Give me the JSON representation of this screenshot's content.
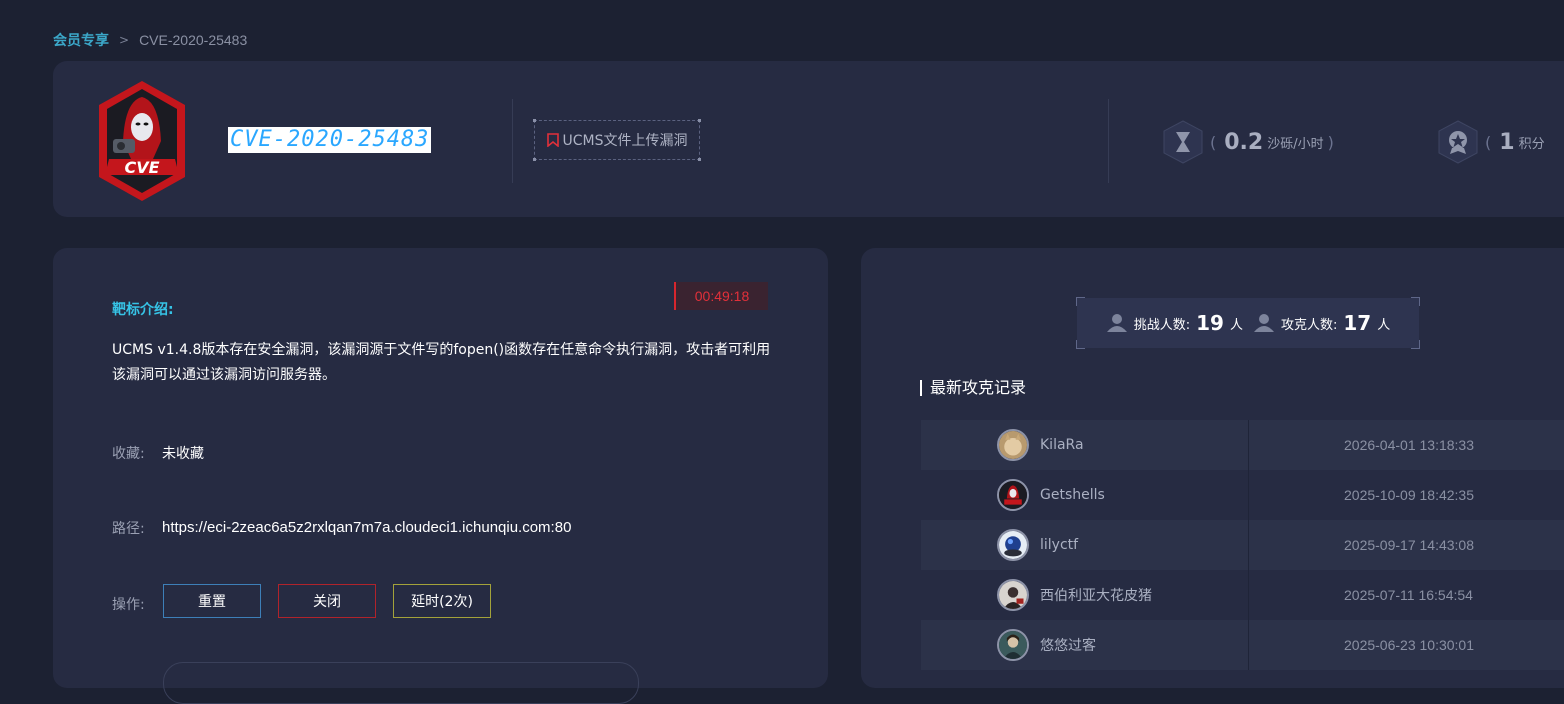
{
  "breadcrumb": {
    "parent": "会员专享",
    "separator": ">",
    "current": "CVE-2020-25483"
  },
  "header": {
    "logo_text": "CVE",
    "title": "CVE-2020-25483",
    "tag": "UCMS文件上传漏洞",
    "stats": [
      {
        "icon": "hourglass-icon",
        "value": "0.2",
        "unit": "沙砾/小时",
        "open": "(",
        "close": ")"
      },
      {
        "icon": "medal-icon",
        "value": "1",
        "unit": "积分",
        "open": "(",
        "close": ""
      }
    ]
  },
  "detail": {
    "timer": "00:49:18",
    "intro_title": "靶标介绍:",
    "intro_desc": "UCMS v1.4.8版本存在安全漏洞，该漏洞源于文件写的fopen()函数存在任意命令执行漏洞，攻击者可利用该漏洞可以通过该漏洞访问服务器。",
    "collect_label": "收藏:",
    "collect_value": "未收藏",
    "path_label": "路径:",
    "path_value": "https://eci-2zeac6a5z2rxlqan7m7a.cloudeci1.ichunqiu.com:80",
    "ops_label": "操作:",
    "ops": [
      {
        "label": "重置",
        "color": "#3d7fb8"
      },
      {
        "label": "关闭",
        "color": "#b0232b"
      },
      {
        "label": "延时(2次)",
        "color": "#a3a23a"
      }
    ]
  },
  "records": {
    "challengers_label": "挑战人数:",
    "challengers_value": "19",
    "challengers_unit": "人",
    "solvers_label": "攻克人数:",
    "solvers_value": "17",
    "solvers_unit": "人",
    "section_title": "最新攻克记录",
    "rows": [
      {
        "name": "KilaRa",
        "time": "2026-04-01 13:18:33",
        "avatar": "cat-avatar"
      },
      {
        "name": "Getshells",
        "time": "2025-10-09 18:42:35",
        "avatar": "cve-avatar"
      },
      {
        "name": "lilyctf",
        "time": "2025-09-17 14:43:08",
        "avatar": "orb-avatar"
      },
      {
        "name": "西伯利亚大花皮猪",
        "time": "2025-07-11 16:54:54",
        "avatar": "person-avatar"
      },
      {
        "name": "悠悠过客",
        "time": "2025-06-23 10:30:01",
        "avatar": "portrait-avatar"
      }
    ]
  },
  "colors": {
    "accent": "#36c3e6",
    "danger": "#e2303a",
    "card": "#262b42",
    "background": "#1c2132"
  }
}
